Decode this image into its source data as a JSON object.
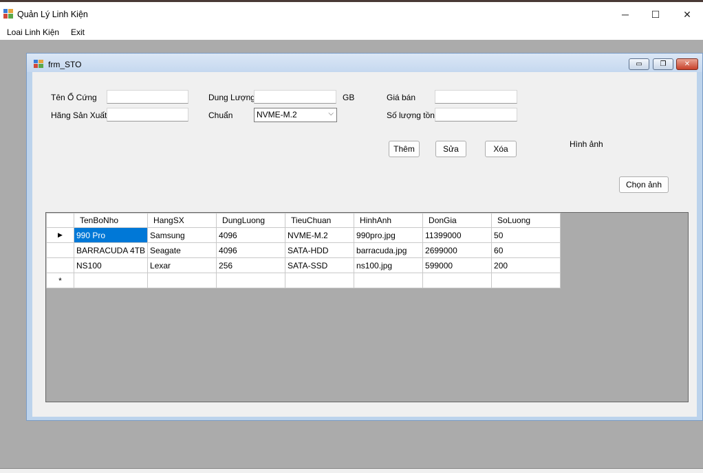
{
  "window": {
    "title": "Quản Lý Linh Kiện",
    "minimize_glyph": "─",
    "maximize_glyph": "☐",
    "close_glyph": "✕"
  },
  "menu": {
    "items": [
      "Loai Linh Kiện",
      "Exit"
    ]
  },
  "child_form": {
    "title": "frm_STO",
    "buttons": {
      "minimize": "▭",
      "restore": "❐",
      "close": "✕"
    }
  },
  "form": {
    "ten_o_cung_label": "Tên Ổ Cứng",
    "ten_o_cung_value": "",
    "hang_sx_label": "Hãng Sản Xuất",
    "hang_sx_value": "",
    "dung_luong_label": "Dung Lượng",
    "dung_luong_value": "",
    "gb_label": "GB",
    "chuan_label": "Chuẩn",
    "chuan_value": "NVME-M.2",
    "gia_ban_label": "Giá bán",
    "gia_ban_value": "",
    "so_luong_ton_label": "Số lượng tồn",
    "so_luong_ton_value": "",
    "hinh_anh_label": "Hình ảnh",
    "them_button": "Thêm",
    "sua_button": "Sửa",
    "xoa_button": "Xóa",
    "chon_anh_button": "Chọn ảnh"
  },
  "grid": {
    "columns": [
      "TenBoNho",
      "HangSX",
      "DungLuong",
      "TieuChuan",
      "HinhAnh",
      "DonGia",
      "SoLuong"
    ],
    "rows": [
      [
        "990 Pro",
        "Samsung",
        "4096",
        "NVME-M.2",
        "990pro.jpg",
        "11399000",
        "50"
      ],
      [
        "BARRACUDA 4TB",
        "Seagate",
        "4096",
        "SATA-HDD",
        "barracuda.jpg",
        "2699000",
        "60"
      ],
      [
        "NS100",
        "Lexar",
        "256",
        "SATA-SSD",
        "ns100.jpg",
        "599000",
        "200"
      ]
    ],
    "current_row_marker": "▶",
    "new_row_marker": "*"
  },
  "colors": {
    "mdi_background": "#ababab",
    "selection": "#0078d7",
    "child_frame": "#bcd3ec"
  }
}
